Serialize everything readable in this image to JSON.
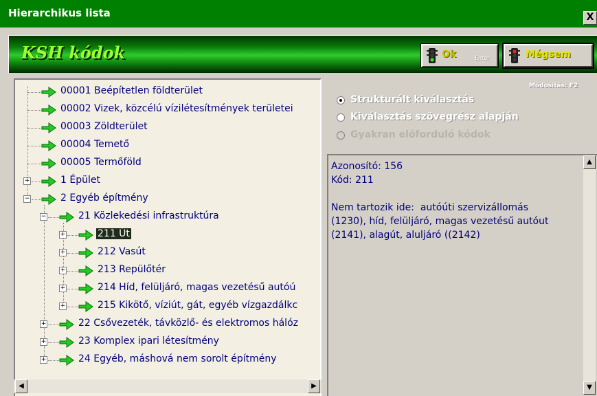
{
  "window": {
    "title": "Hierarchikus lista",
    "close_label": "X"
  },
  "banner": {
    "title": "KSH kódok",
    "ok_label": "Ok",
    "ok_hint": "Enter",
    "cancel_label": "Mégsem"
  },
  "tree": {
    "rows": [
      {
        "label": "00001 Beépítetlen földterület"
      },
      {
        "label": "00002 Vizek, közcélú vízilétesítmények területei"
      },
      {
        "label": "00003 Zöldterület"
      },
      {
        "label": "00004 Temető"
      },
      {
        "label": "00005 Termőföld"
      },
      {
        "label": "1 Épület"
      },
      {
        "label": "2 Egyéb építmény"
      },
      {
        "label": "21 Közlekedési infrastruktúra"
      },
      {
        "label": "211 Út"
      },
      {
        "label": "212 Vasút"
      },
      {
        "label": "213 Repülőtér"
      },
      {
        "label": "214 Híd, felüljáró, magas vezetésű autóú"
      },
      {
        "label": "215 Kikötő, víziút, gát, egyéb vízgazdálkc"
      },
      {
        "label": "22 Csővezeték, távközlő- és elektromos hálóz"
      },
      {
        "label": "23 Komplex ipari létesítmény"
      },
      {
        "label": "24 Egyéb, máshová nem sorolt építmény"
      }
    ]
  },
  "options": {
    "module_hint": "Módosítás: F2",
    "radios": [
      {
        "label": "Strukturált kiválasztás",
        "checked": true
      },
      {
        "label": "Kiválasztás szövegrész alapján",
        "checked": false
      },
      {
        "label": "Gyakran előforduló kódok",
        "checked": false
      }
    ]
  },
  "info": {
    "text": "Azonosító: 156\nKód: 211\n\nNem tartozik ide:  autóúti szervizállomás\n(1230), híd, felüljáró, magas vezetésű autóut\n(2141), alagút, aluljáró ((2142)"
  },
  "colors": {
    "title_bar": "#008000",
    "banner_text": "#9cff30",
    "tree_text": "#00007c",
    "arrow": "#22cc22"
  }
}
